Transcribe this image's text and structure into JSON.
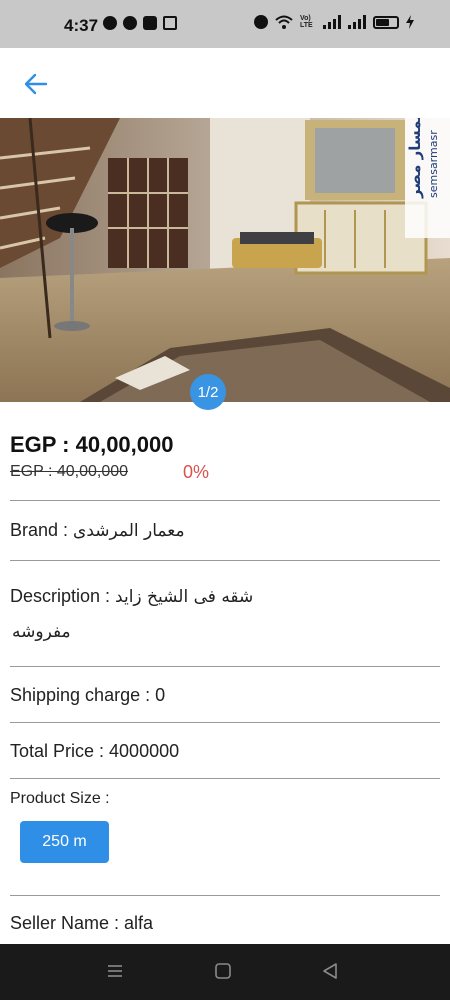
{
  "status_bar": {
    "time": "4:37",
    "left_icons": [
      "facebook-icon",
      "app-icon",
      "grammarly-icon",
      "gmail-icon"
    ],
    "right_icons": [
      "alarm-icon",
      "wifi-icon",
      "volte-icon",
      "signal-icon",
      "signal-icon",
      "battery-icon",
      "charging-icon"
    ],
    "volte_text": "Vo) LTE"
  },
  "header": {
    "back_icon": "arrow-left-icon"
  },
  "gallery": {
    "indicator": "1/2",
    "watermark": "سمسار مصر",
    "watermark_latin": "semsarmasr"
  },
  "product": {
    "price": "EGP : 40,00,000",
    "old_price": "EGP : 40,00,000",
    "discount": "0%",
    "brand_label": "Brand : ",
    "brand_value": "معمار المرشدى",
    "description_label": "Description : ",
    "description_line1": "شقه فى الشيخ زايد",
    "description_line2": "مفروشه",
    "shipping": "Shipping charge : 0",
    "total": "Total Price : 4000000",
    "size_label": "Product Size :",
    "size_option": "250 m",
    "seller": "Seller Name : alfa"
  },
  "colors": {
    "accent": "#2f8fe6",
    "discount": "#d9534f",
    "statusbar": "#c8c8c8",
    "navbar": "#1a1a1a"
  }
}
